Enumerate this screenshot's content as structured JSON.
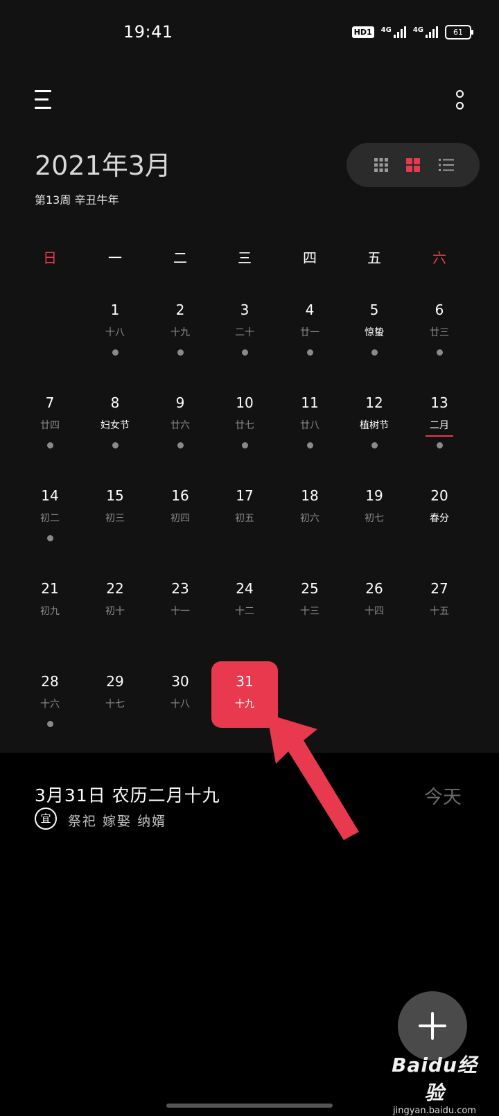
{
  "status_bar": {
    "time": "19:41",
    "hd_badge": "HD1",
    "network_1": "4G",
    "network_2": "4G",
    "battery": "61"
  },
  "header": {
    "menu_icon": "hamburger-menu-icon",
    "more_icon": "vertical-more-icon",
    "month_title": "2021年3月",
    "sub_title": "第13周 辛丑牛年",
    "view_switch": {
      "options": [
        "month-grid-9-icon",
        "month-grid-4-icon",
        "list-icon"
      ],
      "selected": "month-grid-4-icon",
      "accent_color": "#e8394e"
    }
  },
  "calendar": {
    "weekdays": [
      "日",
      "一",
      "二",
      "三",
      "四",
      "五",
      "六"
    ],
    "weeks": [
      [
        null,
        {
          "day": "1",
          "lunar": "十八",
          "dot": true
        },
        {
          "day": "2",
          "lunar": "十九",
          "dot": true
        },
        {
          "day": "3",
          "lunar": "二十",
          "dot": true
        },
        {
          "day": "4",
          "lunar": "廿一",
          "dot": true
        },
        {
          "day": "5",
          "lunar": "惊蛰",
          "dot": true,
          "highlight": true
        },
        {
          "day": "6",
          "lunar": "廿三",
          "dot": true
        }
      ],
      [
        {
          "day": "7",
          "lunar": "廿四",
          "dot": true
        },
        {
          "day": "8",
          "lunar": "妇女节",
          "dot": true,
          "highlight": true
        },
        {
          "day": "9",
          "lunar": "廿六",
          "dot": true
        },
        {
          "day": "10",
          "lunar": "廿七",
          "dot": true
        },
        {
          "day": "11",
          "lunar": "廿八",
          "dot": true
        },
        {
          "day": "12",
          "lunar": "植树节",
          "dot": true,
          "highlight": true
        },
        {
          "day": "13",
          "lunar": "二月",
          "dot": true,
          "highlight": true,
          "underline": true
        }
      ],
      [
        {
          "day": "14",
          "lunar": "初二",
          "dot": true
        },
        {
          "day": "15",
          "lunar": "初三"
        },
        {
          "day": "16",
          "lunar": "初四"
        },
        {
          "day": "17",
          "lunar": "初五"
        },
        {
          "day": "18",
          "lunar": "初六"
        },
        {
          "day": "19",
          "lunar": "初七"
        },
        {
          "day": "20",
          "lunar": "春分",
          "highlight": true
        }
      ],
      [
        {
          "day": "21",
          "lunar": "初九"
        },
        {
          "day": "22",
          "lunar": "初十"
        },
        {
          "day": "23",
          "lunar": "十一"
        },
        {
          "day": "24",
          "lunar": "十二"
        },
        {
          "day": "25",
          "lunar": "十三"
        },
        {
          "day": "26",
          "lunar": "十四"
        },
        {
          "day": "27",
          "lunar": "十五"
        }
      ],
      [
        {
          "day": "28",
          "lunar": "十六",
          "dot": true
        },
        {
          "day": "29",
          "lunar": "十七"
        },
        {
          "day": "30",
          "lunar": "十八"
        },
        {
          "day": "31",
          "lunar": "十九",
          "selected": true
        },
        null,
        null,
        null
      ]
    ]
  },
  "selected_info": {
    "date_text": "3月31日   农历二月十九",
    "today_label": "今天",
    "yi_label": "宜",
    "yi_items": "祭祀 嫁娶 纳婿"
  },
  "fab": {
    "icon": "plus-icon"
  },
  "watermark": {
    "logo": "Baidu经验",
    "url": "jingyan.baidu.com"
  },
  "colors": {
    "accent": "#e8394e",
    "background": "#000000",
    "calendar_background": "#121212",
    "muted_text": "#8a8a8a"
  }
}
